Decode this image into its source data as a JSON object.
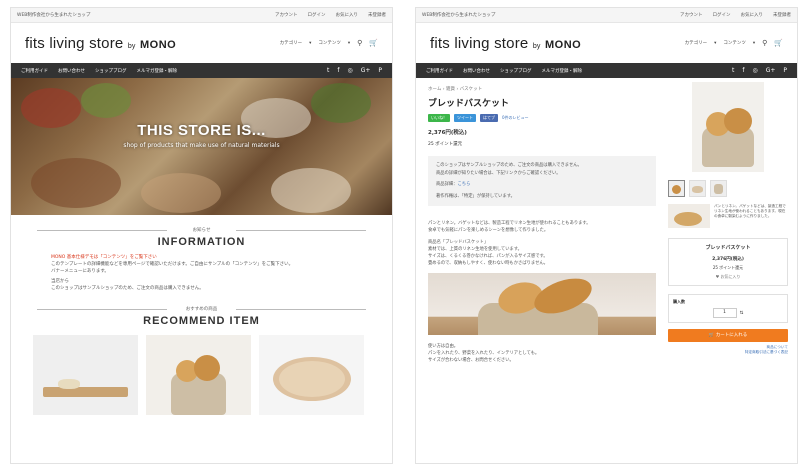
{
  "site": {
    "topbar_text": "WEB制作会社から生まれたショップ",
    "topbar_links": [
      "アカウント",
      "ログイン",
      "お気に入り",
      "未登録者"
    ],
    "logo_main": "fits living store",
    "logo_by": "by",
    "logo_brand": "MONO",
    "header_menus": [
      "カテゴリー",
      "コンテンツ"
    ],
    "nav_items": [
      "ご利用ガイド",
      "お問い合わせ",
      "ショップブログ",
      "メルマガ登録・解除"
    ],
    "social_icons": [
      "twitter-icon",
      "facebook-icon",
      "instagram-icon",
      "google-plus-icon",
      "pinterest-icon"
    ]
  },
  "left": {
    "hero_title": "THIS STORE IS...",
    "hero_subtitle": "shop of products that make use of natural materials",
    "info_ja": "お知らせ",
    "info_en": "INFORMATION",
    "info_red": "MONO 基本仕様デモは「コンテンツ」をご覧下さい",
    "info_text_1": "このテンプレートの詳細機能などを専用ページで確認いただけます。ご自由にサンプルの「コンテンツ」をご覧下さい。",
    "info_text_2": "バナーメニューにあります。",
    "info_text_3": "当店から",
    "info_text_4": "このショップはサンプルショップのため、ご注文の商品は購入できません。",
    "rec_ja": "おすすめの商品",
    "rec_en": "RECOMMEND ITEM"
  },
  "right": {
    "breadcrumb": "ホーム › 雑貨 › バスケット",
    "product_title": "ブレッドバスケット",
    "social_buttons": [
      "いいね！",
      "ツイート",
      "はてブ"
    ],
    "review_link": "0件のレビュー",
    "price": "2,376円(税込)",
    "points": "25 ポイント還元",
    "notice_1": "このショップはサンプルショップのため、ご注文の商品は購入できません。",
    "notice_2": "商品の詳細が知りたい場合は、下記リンクからご確認ください。",
    "notice_3": "商品詳細：",
    "notice_link": "こちら",
    "notice_4": "著作作権は、「特定」が保持しています。",
    "desc_1": "パンとリネン。バゲットなどは、製造工程でリネン生地が使われることもあります。",
    "desc_2": "食卓でも気軽にパンを楽しめるシーンを想像して作りました。",
    "desc_3": "商品名「ブレッドバスケット」",
    "desc_4": "素材では、上質のリネン生地を使用しています。",
    "desc_5": "サイズは、くるくる巻かなければ、パンが入るサイズ感です。",
    "desc_6": "畳めるので、収納もしやすく、使わない時もかさばりません。",
    "after_1": "使い方は自由。",
    "after_2": "パンを入れたり、野菜を入れたり、インテリアとしても。",
    "after_3": "サイズが合わない場合、お問合せください。",
    "side_caption": "パンとリネン。パゲットなどは、製造工程でリネン生地が使われることもあります。現在の食卓に馴染むように作りました。",
    "buy_name": "ブレッドバスケット",
    "buy_price": "2,376円(税込)",
    "buy_points": "25 ポイント還元",
    "buy_fav": "お気に入り",
    "qty_label": "購入数",
    "qty_value": "1",
    "cart_label": "カートに入れる",
    "below_1": "商品について",
    "below_2": "特定商取引法に基づく表記"
  }
}
